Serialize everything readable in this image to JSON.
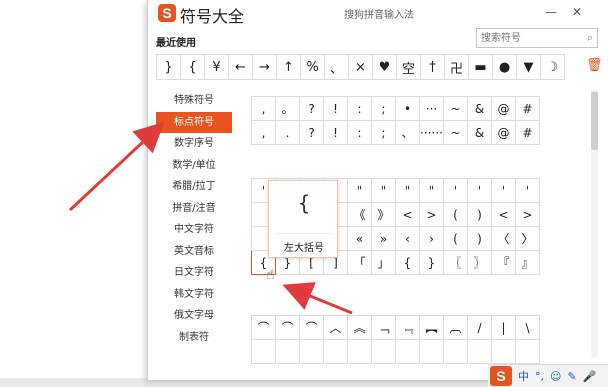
{
  "window": {
    "logo": "S",
    "title": "符号大全",
    "subtitle": "搜狗拼音输入法",
    "minimize": "—",
    "close": "✕"
  },
  "recent": {
    "label": "最近使用",
    "symbols": [
      "}",
      "{",
      "¥",
      "←",
      "→",
      "↑",
      "%",
      "、",
      "×",
      "♥",
      "空",
      "†",
      "卍",
      "▬",
      "●",
      "▼",
      "☽"
    ],
    "trash_icon": "trash-icon"
  },
  "search": {
    "placeholder": "搜索符号",
    "icon": "search-icon"
  },
  "sidebar": {
    "items": [
      {
        "label": "特殊符号"
      },
      {
        "label": "标点符号"
      },
      {
        "label": "数字序号"
      },
      {
        "label": "数学/单位"
      },
      {
        "label": "希腊/拉丁"
      },
      {
        "label": "拼音/注音"
      },
      {
        "label": "中文字符"
      },
      {
        "label": "英文音标"
      },
      {
        "label": "日文字符"
      },
      {
        "label": "韩文字符"
      },
      {
        "label": "俄文字母"
      },
      {
        "label": "制表符"
      }
    ],
    "active_index": 1
  },
  "grid1": {
    "rows": [
      [
        ",",
        "。",
        "?",
        "!",
        ":",
        ";",
        "•",
        "···",
        "~",
        "&",
        "@",
        "#"
      ],
      [
        ",",
        ".",
        "?",
        "!",
        ":",
        ";",
        "、",
        "······",
        "~",
        "&",
        "@",
        "#"
      ]
    ]
  },
  "grid2": {
    "rows": [
      [
        "'",
        "",
        "",
        "'",
        "\"",
        "\"",
        "\"",
        "\"",
        "'",
        "'",
        "'",
        "'"
      ],
      [
        "",
        "",
        "",
        "】",
        "《",
        "》",
        "<",
        ">",
        "(",
        ")",
        "<",
        ">"
      ],
      [
        "",
        "",
        "",
        "]",
        "«",
        "»",
        "‹",
        "›",
        "(",
        ")",
        "〈",
        "〉"
      ],
      [
        "{",
        "}",
        "[",
        "]",
        "「",
        "」",
        "{",
        "}",
        "〖",
        "〗",
        "『",
        "』"
      ]
    ],
    "hover_cell": "{"
  },
  "grid3": {
    "rows": [
      [
        "⌒",
        "⌒",
        "⌒",
        "︿",
        "︽",
        "﹁",
        "﹃",
        "︻",
        "︹",
        "/",
        "|",
        "\\"
      ],
      [
        "",
        "",
        "",
        "",
        "",
        "",
        "",
        "",
        "",
        "",
        "",
        ""
      ]
    ]
  },
  "tooltip": {
    "symbol": "{",
    "name": "左大括号"
  },
  "taskbar": {
    "logo": "S",
    "lang": "中",
    "punct": "°,",
    "emoji": "☺",
    "pen": "✎",
    "mic": "🎤"
  },
  "colors": {
    "accent": "#e8541f",
    "arrow": "#e23b3b"
  }
}
